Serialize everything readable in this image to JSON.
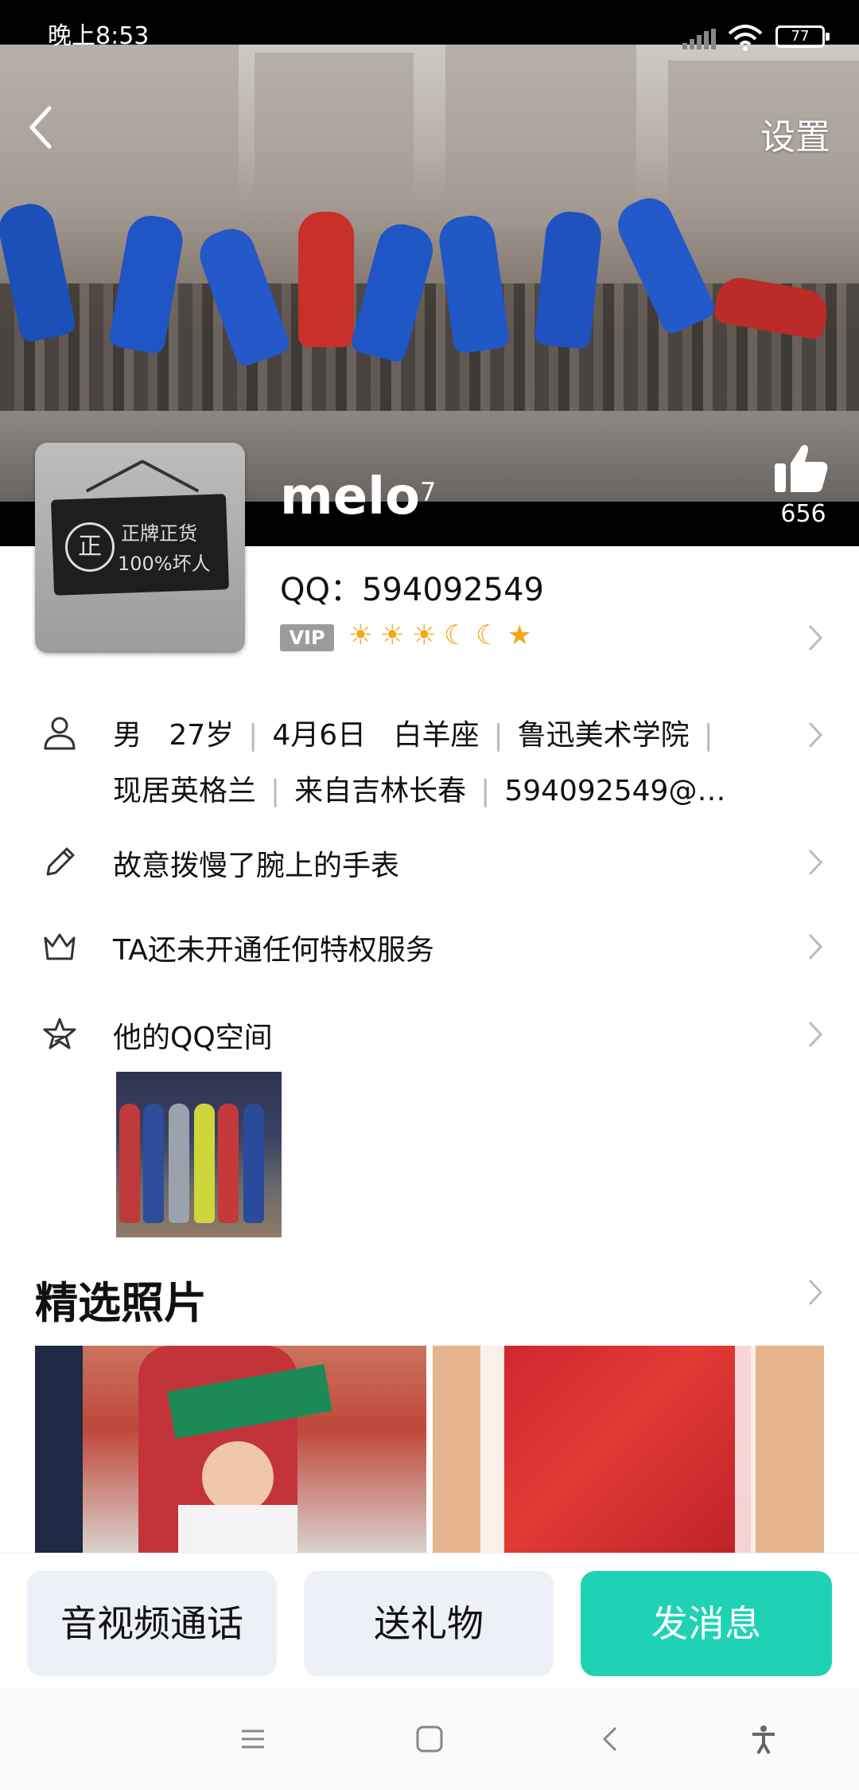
{
  "status_bar": {
    "time": "晚上8:53",
    "battery": "77"
  },
  "header": {
    "settings_label": "设置",
    "likes": "656"
  },
  "profile": {
    "nickname": "melo",
    "nickname_sup": "7",
    "avatar_text_seal": "正",
    "avatar_text_line1": "正牌正货",
    "avatar_text_line2": "100%坏人",
    "qq_label": "QQ：594092549",
    "vip_badge": "VIP",
    "level_icons": [
      "sun-icon",
      "sun-icon",
      "sun-icon",
      "moon-icon",
      "moon-icon",
      "star-icon"
    ]
  },
  "info": {
    "line1": [
      "男",
      "27岁",
      "4月6日",
      "白羊座",
      "鲁迅美术学院"
    ],
    "line2": [
      "现居英格兰",
      "来自吉林长春",
      "594092549@…"
    ],
    "signature": "故意拨慢了腕上的手表",
    "privilege": "TA还未开通任何特权服务",
    "zone": "他的QQ空间"
  },
  "featured": {
    "title": "精选照片"
  },
  "actions": {
    "call": "音视频通话",
    "gift": "送礼物",
    "message": "发消息"
  },
  "colors": {
    "primary": "#1fd2b4",
    "button_grey": "#eef0f7",
    "level_gold": "#f2a81d"
  }
}
